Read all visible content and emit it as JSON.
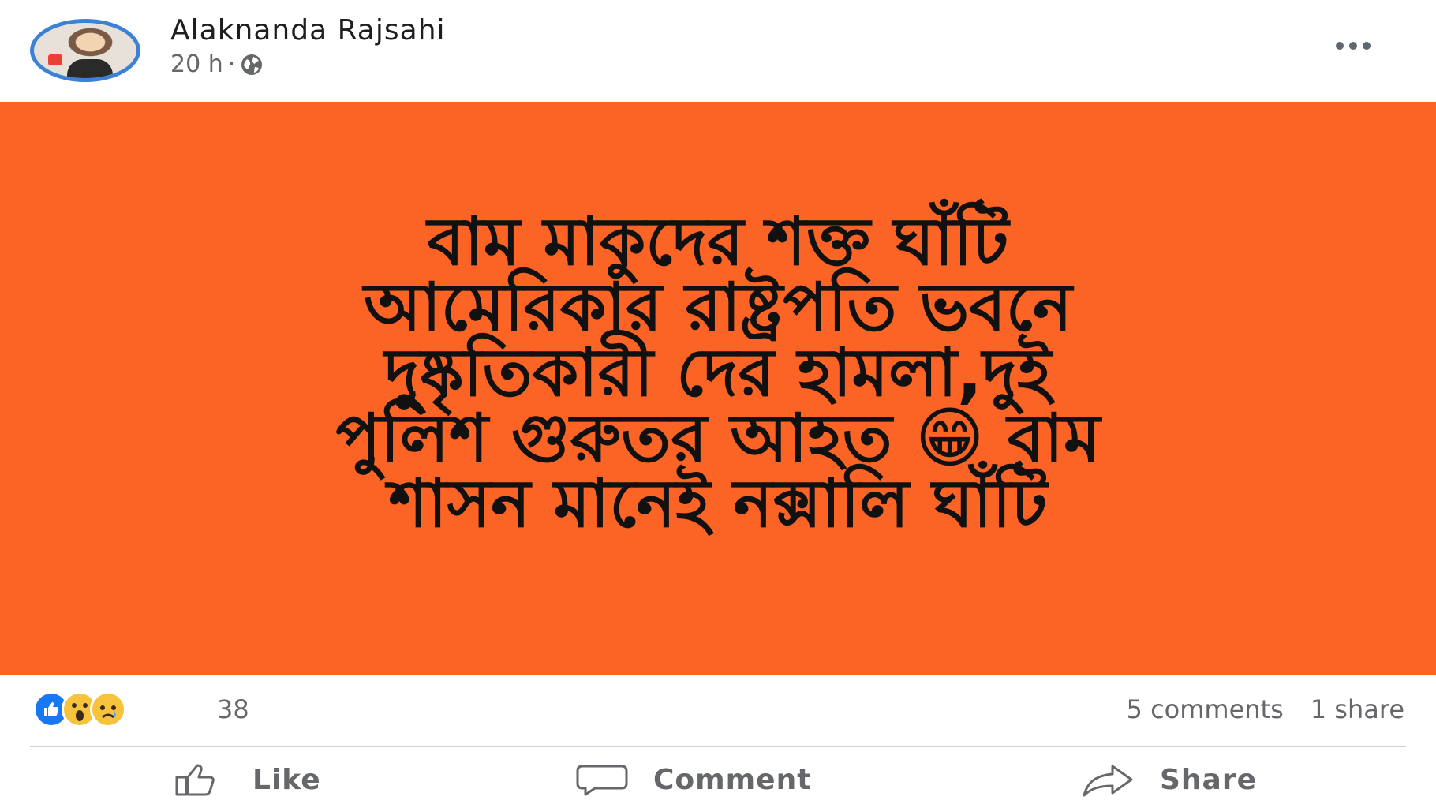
{
  "post": {
    "author": "Alaknanda Rajsahi",
    "time": "20 h",
    "separator": "·",
    "privacy_icon": "globe-icon",
    "more_icon": "more-dots-icon",
    "banner": {
      "background": "#fb6424",
      "text_lines": [
        "বাম মাকুদের শক্ত ঘাঁটি",
        "আমেরিকার রাষ্ট্রপতি ভবনে",
        "দুষ্কৃতিকারী দের হামলা,দুই",
        "পুলিশ গুরুতর আহত 😁 বাম",
        "শাসন মানেই নক্সালি ঘাঁটি"
      ]
    },
    "reactions": {
      "icons": [
        "like-icon",
        "wow-icon",
        "sad-icon"
      ],
      "count": "38"
    },
    "comments": "5 comments",
    "shares": "1 share",
    "actions": {
      "like": "Like",
      "comment": "Comment",
      "share": "Share"
    }
  }
}
